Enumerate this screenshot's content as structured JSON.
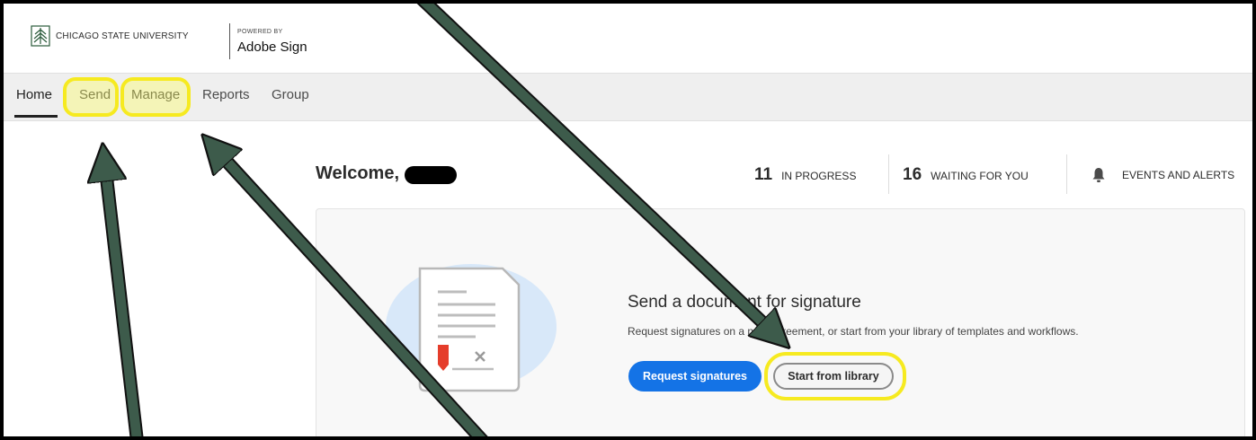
{
  "header": {
    "university": "CHICAGO STATE UNIVERSITY",
    "powered_by": "POWERED BY",
    "product": "Adobe Sign"
  },
  "nav": {
    "items": [
      {
        "label": "Home",
        "active": true
      },
      {
        "label": "Send"
      },
      {
        "label": "Manage"
      },
      {
        "label": "Reports"
      },
      {
        "label": "Group"
      }
    ]
  },
  "welcome": {
    "label": "Welcome,"
  },
  "stats": {
    "in_progress": {
      "count": "11",
      "label": "IN PROGRESS"
    },
    "waiting": {
      "count": "16",
      "label": "WAITING FOR YOU"
    },
    "events": {
      "label": "EVENTS AND ALERTS"
    }
  },
  "send_card": {
    "title": "Send a document for signature",
    "subtitle": "Request signatures on a new agreement, or start from your library of templates and workflows.",
    "primary_button": "Request signatures",
    "secondary_button": "Start from library"
  },
  "colors": {
    "accent_blue": "#1473e6",
    "highlight_yellow": "#f6ea20",
    "arrow_green": "#3d5b4b"
  },
  "icons": [
    "university-logo-icon",
    "bell-icon",
    "document-illustration-icon"
  ]
}
